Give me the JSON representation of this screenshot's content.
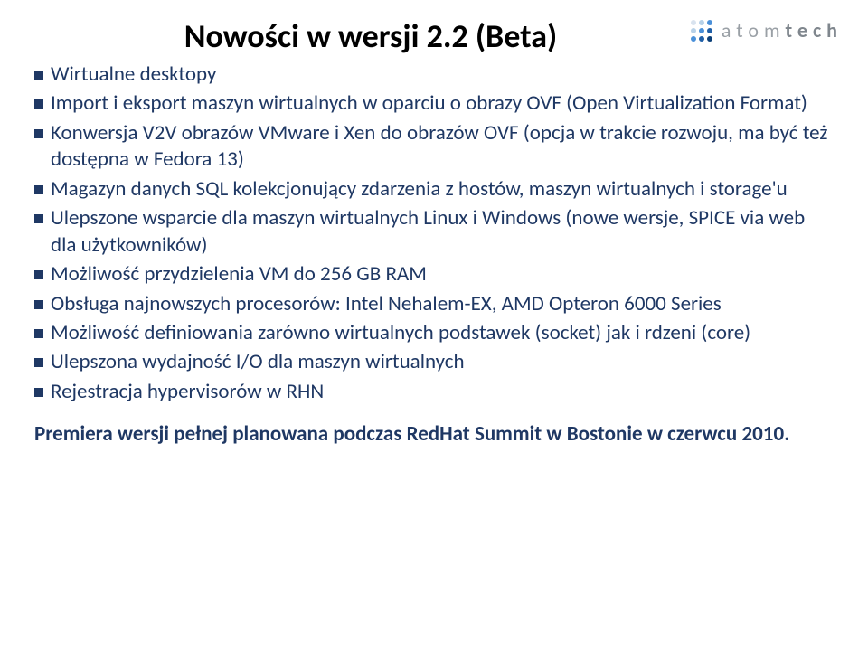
{
  "logo": {
    "brand_left": "atom",
    "brand_right": "tech"
  },
  "title": "Nowości w wersji 2.2 (Beta)",
  "bullets": [
    "Wirtualne desktopy",
    "Import i eksport maszyn wirtualnych w oparciu o obrazy OVF (Open Virtualization Format)",
    "Konwersja V2V obrazów VMware i Xen do obrazów OVF (opcja w trakcie rozwoju, ma być też dostępna w Fedora 13)",
    "Magazyn danych SQL kolekcjonujący zdarzenia z hostów, maszyn wirtualnych i storage'u",
    "Ulepszone wsparcie dla maszyn wirtualnych Linux i Windows (nowe wersje, SPICE via web dla użytkowników)",
    "Możliwość przydzielenia VM do 256 GB RAM",
    "Obsługa najnowszych procesorów: Intel Nehalem-EX, AMD Opteron 6000 Series",
    "Możliwość definiowania zarówno wirtualnych podstawek (socket) jak i rdzeni (core)",
    "Ulepszona wydajność I/O dla maszyn wirtualnych",
    "Rejestracja hypervisorów w RHN"
  ],
  "footer": "Premiera wersji pełnej planowana podczas RedHat Summit w Bostonie w czerwcu 2010.",
  "logo_dot_colors": [
    "#d9e3ef",
    "#b7d1e8",
    "#4a90d9",
    "#b7d1e8",
    "#4a90d9",
    "#1f5fa8",
    "#4a90d9",
    "#1f5fa8",
    "#0b3f78"
  ]
}
